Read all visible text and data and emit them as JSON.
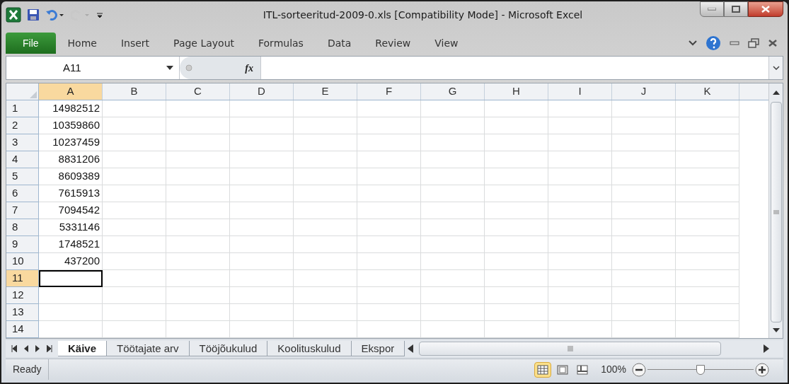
{
  "window": {
    "title": "ITL-sorteeritud-2009-0.xls  [Compatibility Mode]  -  Microsoft Excel"
  },
  "ribbon": {
    "file_button": "File",
    "tabs": [
      {
        "label": "Home",
        "selected": false
      },
      {
        "label": "Insert",
        "selected": false
      },
      {
        "label": "Page Layout",
        "selected": false
      },
      {
        "label": "Formulas",
        "selected": false
      },
      {
        "label": "Data",
        "selected": false
      },
      {
        "label": "Review",
        "selected": false
      },
      {
        "label": "View",
        "selected": false
      }
    ]
  },
  "formula_bar": {
    "name_box": "A11",
    "function_button": "fx"
  },
  "columns": [
    {
      "label": "A",
      "selected": true
    },
    {
      "label": "B",
      "selected": false
    },
    {
      "label": "C",
      "selected": false
    },
    {
      "label": "D",
      "selected": false
    },
    {
      "label": "E",
      "selected": false
    },
    {
      "label": "F",
      "selected": false
    },
    {
      "label": "G",
      "selected": false
    },
    {
      "label": "H",
      "selected": false
    },
    {
      "label": "I",
      "selected": false
    },
    {
      "label": "J",
      "selected": false
    },
    {
      "label": "K",
      "selected": false
    }
  ],
  "rows": [
    {
      "header": "1",
      "selected": false,
      "cells": [
        "14982512"
      ]
    },
    {
      "header": "2",
      "selected": false,
      "cells": [
        "10359860"
      ]
    },
    {
      "header": "3",
      "selected": false,
      "cells": [
        "10237459"
      ]
    },
    {
      "header": "4",
      "selected": false,
      "cells": [
        "8831206"
      ]
    },
    {
      "header": "5",
      "selected": false,
      "cells": [
        "8609389"
      ]
    },
    {
      "header": "6",
      "selected": false,
      "cells": [
        "7615913"
      ]
    },
    {
      "header": "7",
      "selected": false,
      "cells": [
        "7094542"
      ]
    },
    {
      "header": "8",
      "selected": false,
      "cells": [
        "5331146"
      ]
    },
    {
      "header": "9",
      "selected": false,
      "cells": [
        "1748521"
      ]
    },
    {
      "header": "10",
      "selected": false,
      "cells": [
        "437200"
      ]
    },
    {
      "header": "11",
      "selected": true,
      "cells": []
    },
    {
      "header": "12",
      "selected": false,
      "cells": []
    },
    {
      "header": "13",
      "selected": false,
      "cells": []
    },
    {
      "header": "14",
      "selected": false,
      "cells": []
    }
  ],
  "sheet_tabs": [
    {
      "label": "Käive",
      "selected": true
    },
    {
      "label": "Töötajate arv",
      "selected": false
    },
    {
      "label": "Tööjõukulud",
      "selected": false
    },
    {
      "label": "Koolituskulud",
      "selected": false
    },
    {
      "label": "Ekspor",
      "selected": false
    }
  ],
  "status_bar": {
    "status": "Ready",
    "zoom": "100%",
    "zoom_level": {
      "level": 0.5
    },
    "views": [
      {
        "kind": "normal",
        "selected": true
      },
      {
        "kind": "page_layout",
        "selected": false
      },
      {
        "kind": "page_break",
        "selected": false
      }
    ]
  }
}
